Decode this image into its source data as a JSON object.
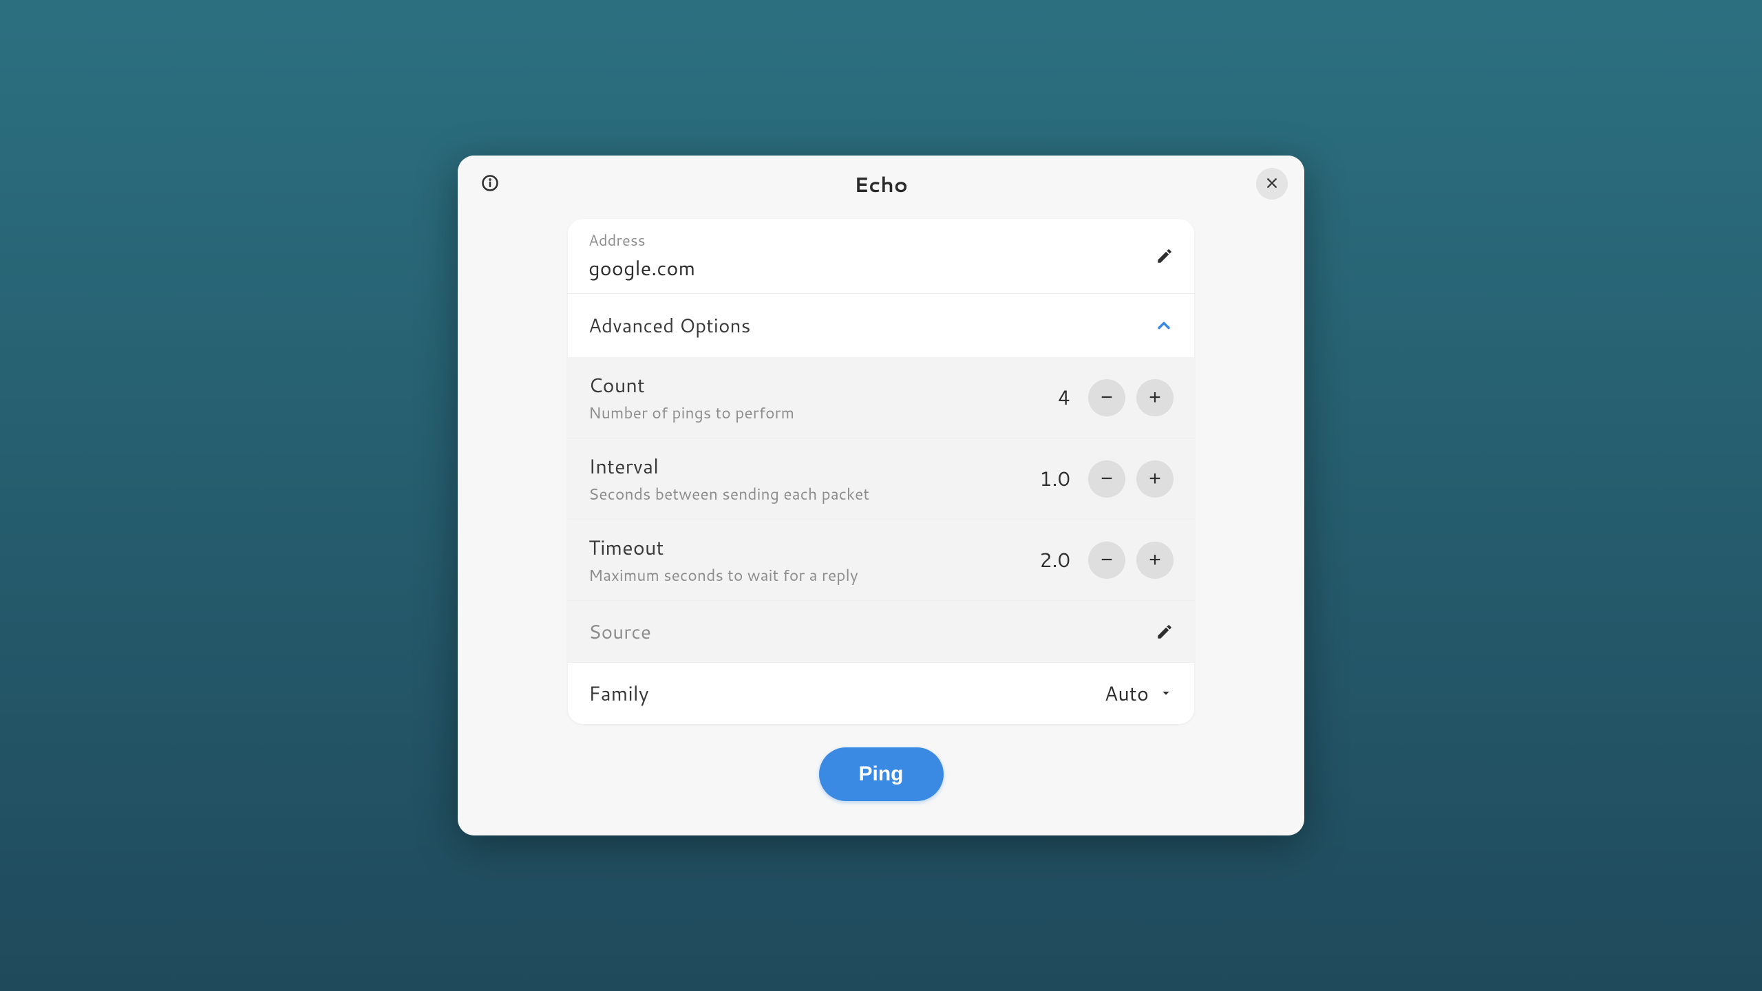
{
  "window": {
    "title": "Echo"
  },
  "address": {
    "label": "Address",
    "value": "google.com"
  },
  "advanced": {
    "header": "Advanced Options",
    "count": {
      "label": "Count",
      "desc": "Number of pings to perform",
      "value": "4"
    },
    "interval": {
      "label": "Interval",
      "desc": "Seconds between sending each packet",
      "value": "1.0"
    },
    "timeout": {
      "label": "Timeout",
      "desc": "Maximum seconds to wait for a reply",
      "value": "2.0"
    },
    "source": {
      "label": "Source"
    },
    "family": {
      "label": "Family",
      "value": "Auto"
    }
  },
  "actions": {
    "ping": "Ping"
  }
}
